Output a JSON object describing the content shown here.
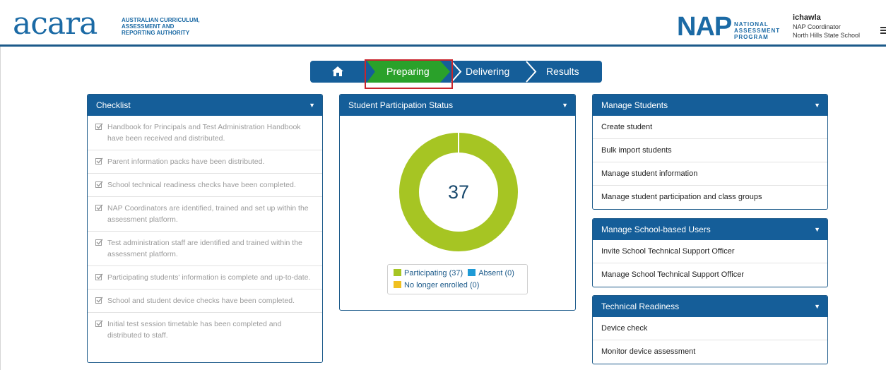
{
  "header": {
    "acara_logo_text": "acara",
    "acara_sub": [
      "AUSTRALIAN CURRICULUM,",
      "ASSESSMENT AND",
      "REPORTING AUTHORITY"
    ],
    "nap_logo_text": "NAP",
    "nap_sub": [
      "NATIONAL",
      "ASSESSMENT",
      "PROGRAM"
    ],
    "user": {
      "name": "ichawla",
      "role": "NAP Coordinator",
      "school": "North Hills State School"
    }
  },
  "nav": {
    "steps": [
      {
        "label": "Preparing",
        "active": true
      },
      {
        "label": "Delivering",
        "active": false
      },
      {
        "label": "Results",
        "active": false
      }
    ]
  },
  "checklist": {
    "title": "Checklist",
    "items": [
      "Handbook for Principals and Test Administration Handbook have been received and distributed.",
      "Parent information packs have been distributed.",
      "School technical readiness checks have been completed.",
      "NAP Coordinators are identified, trained and set up within the assessment platform.",
      "Test administration staff are identified and trained within the assessment platform.",
      "Participating students' information is complete and up-to-date.",
      "School and student device checks have been completed.",
      "Initial test session timetable has been completed and distributed to staff."
    ]
  },
  "participation": {
    "title": "Student Participation Status",
    "total": "37",
    "legend": {
      "participating": "Participating (37)",
      "absent": "Absent (0)",
      "no_longer_enrolled": "No longer enrolled (0)"
    },
    "values": {
      "participating": 37,
      "absent": 0,
      "no_longer_enrolled": 0
    },
    "colors": {
      "participating": "#a6c523",
      "absent": "#1e9ad6",
      "no_longer_enrolled": "#f0c020"
    }
  },
  "manage_students": {
    "title": "Manage Students",
    "items": [
      "Create student",
      "Bulk import students",
      "Manage student information",
      "Manage student participation and class groups"
    ]
  },
  "manage_users": {
    "title": "Manage School-based Users",
    "items": [
      "Invite School Technical Support Officer",
      "Manage School Technical Support Officer"
    ]
  },
  "tech_readiness": {
    "title": "Technical Readiness",
    "items": [
      "Device check",
      "Monitor device assessment"
    ]
  },
  "colors": {
    "brand_blue": "#155e99",
    "active_green": "#2aa12a",
    "highlight_red": "#c9252c"
  }
}
